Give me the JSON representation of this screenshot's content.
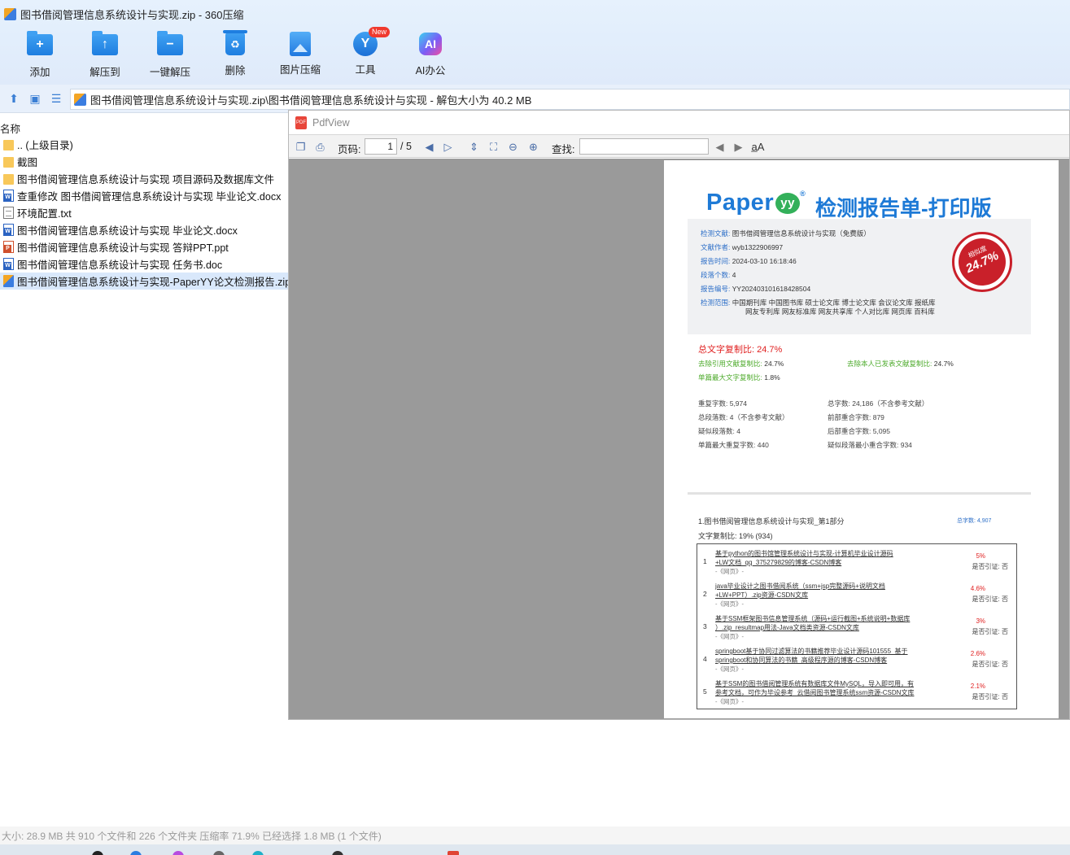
{
  "window": {
    "title": "图书借阅管理信息系统设计与实现.zip - 360压缩"
  },
  "toolbar": {
    "buttons": [
      {
        "label": "添加",
        "icon": "add-folder-icon"
      },
      {
        "label": "解压到",
        "icon": "extract-to-icon"
      },
      {
        "label": "一键解压",
        "icon": "one-click-extract-icon"
      },
      {
        "label": "删除",
        "icon": "recycle-bin-icon"
      },
      {
        "label": "图片压缩",
        "icon": "image-compress-icon"
      },
      {
        "label": "工具",
        "icon": "tools-icon",
        "badge": "New"
      },
      {
        "label": "AI办公",
        "icon": "ai-office-icon"
      }
    ]
  },
  "address": {
    "path": "图书借阅管理信息系统设计与实现.zip\\图书借阅管理信息系统设计与实现 - 解包大小为 40.2 MB"
  },
  "filelist": {
    "column_name": "名称",
    "items": [
      {
        "name": ".. (上级目录)",
        "type": "folder"
      },
      {
        "name": "截图",
        "type": "folder"
      },
      {
        "name": "图书借阅管理信息系统设计与实现 项目源码及数据库文件",
        "type": "folder"
      },
      {
        "name": "查重修改 图书借阅管理信息系统设计与实现 毕业论文.docx",
        "type": "word"
      },
      {
        "name": "环境配置.txt",
        "type": "txt"
      },
      {
        "name": "图书借阅管理信息系统设计与实现 毕业论文.docx",
        "type": "word"
      },
      {
        "name": "图书借阅管理信息系统设计与实现 答辩PPT.ppt",
        "type": "ppt"
      },
      {
        "name": "图书借阅管理信息系统设计与实现 任务书.doc",
        "type": "word"
      },
      {
        "name": "图书借阅管理信息系统设计与实现-PaperYY论文检测报告.zip",
        "type": "zip",
        "selected": true
      }
    ]
  },
  "pdfview": {
    "title": "PdfView",
    "page_label": "页码:",
    "page_current": "1",
    "page_total": "/ 5",
    "find_label": "查找:",
    "find_value": ""
  },
  "report": {
    "brand": "Paper",
    "brand_mark": "yy",
    "brand_reg": "®",
    "title": "检测报告单-打印版",
    "info": [
      {
        "key": "检测文献:",
        "value": "图书借阅管理信息系统设计与实现（免费版）"
      },
      {
        "key": "文献作者:",
        "value": "wyb1322906997"
      },
      {
        "key": "报告时间:",
        "value": "2024-03-10 16:18:46"
      },
      {
        "key": "段落个数:",
        "value": "4"
      },
      {
        "key": "报告编号:",
        "value": "YY20240310161842850​4"
      },
      {
        "key": "检测范围:",
        "value": "中国期刊库 中国图书库 硕士论文库 博士论文库 会议论文库 报纸库",
        "value2": "网友专利库 网友标准库 网友共享库 个人对比库 网页库 百科库"
      }
    ],
    "stamp": {
      "label": "相似度",
      "value": "24.7%"
    },
    "total_rate": "总文字复制比: 24.7%",
    "rates": [
      {
        "key": "去除引用文献复制比:",
        "value": "24.7%"
      },
      {
        "key": "去除本人已发表文献复制比:",
        "value": "24.7%"
      },
      {
        "key": "单篇最大文字复制比:",
        "value": "1.8%"
      }
    ],
    "stats": [
      "重复字数: 5,974",
      "总字数: 24,186（不含参考文献）",
      "总段落数: 4（不含参考文献）",
      "前部重合字数: 879",
      "疑似段落数: 4",
      "后部重合字数: 5,095",
      "单篇最大重复字数: 440",
      "疑似段落最小重合字数: 934"
    ],
    "section": {
      "title": "1.图书借阅管理信息系统设计与实现_第1部分",
      "total": "总字数: 4,907",
      "rate": "文字复制比: 19% (934)"
    },
    "refs": [
      {
        "num": "1",
        "line1": "基于python的图书馆管理系统设计与实现-计算机毕业设计源码",
        "line2": "+LW文档_qq_375279829的博客-CSDN博客",
        "source": "-《网页》-",
        "pct": "5%",
        "cite": "是否引证: 否"
      },
      {
        "num": "2",
        "line1": "java毕业设计之图书借阅系统（ssm+jsp完整源码+说明文档",
        "line2": "+LW+PPT）.zip资源-CSDN文库",
        "source": "-《网页》-",
        "pct": "4.6%",
        "cite": "是否引证: 否"
      },
      {
        "num": "3",
        "line1": "基于SSM框架图书信息管理系统（源码+运行截图+系统说明+数据库",
        "line2": "）.zip_resultmap用法-Java文档类资源-CSDN文库",
        "source": "-《网页》-",
        "pct": "3%",
        "cite": "是否引证: 否"
      },
      {
        "num": "4",
        "line1": "springboot基于协同过滤算法的书籍推荐毕业设计源码101555_基于",
        "line2": "springboot和协同算法的书籍_高级程序源的博客-CSDN博客",
        "source": "-《网页》-",
        "pct": "2.6%",
        "cite": "是否引证: 否"
      },
      {
        "num": "5",
        "line1": "基于SSM的图书借阅管理系统有数据库文件MySQL，导入即可用，有",
        "line2": "参考文档，可作为毕设参考_云借阅图书管理系统ssm资源-CSDN文库",
        "source": "-《网页》-",
        "pct": "2.1%",
        "cite": "是否引证: 否"
      }
    ]
  },
  "status": {
    "text": "大小: 28.9 MB 共 910 个文件和 226 个文件夹 压缩率 71.9% 已经选择 1.8 MB (1 个文件)"
  }
}
